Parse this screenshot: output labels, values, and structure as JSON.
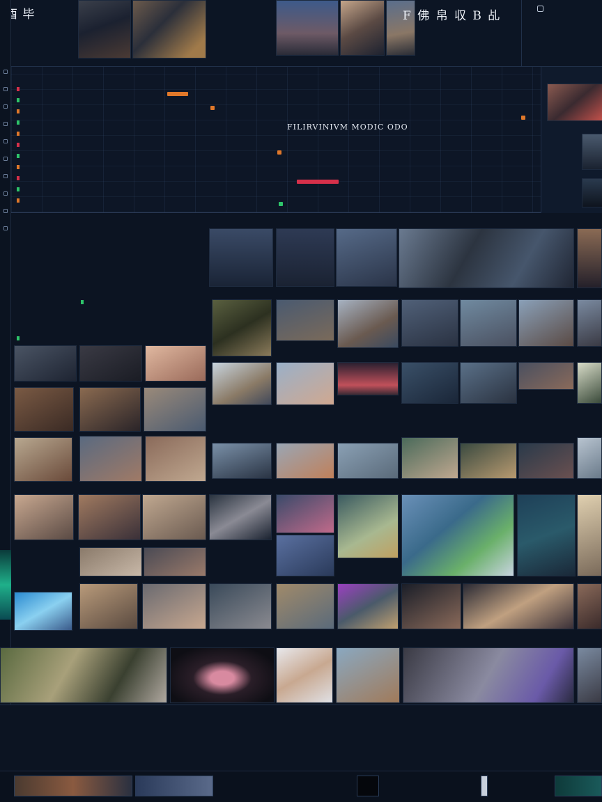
{
  "header": {
    "app_title": "酉 毕",
    "title_right": "F 佛 帛  収 B 乩"
  },
  "dashboard": {
    "heading": "FILIRVINIVM  MODIC ODO"
  },
  "colors": {
    "background": "#0e1727",
    "panel": "#0c1422",
    "accent_orange": "#e0782a",
    "accent_green": "#2ec46a",
    "accent_red": "#d6304a",
    "accent_teal": "#1fb08a"
  },
  "icons": [
    "settings-icon",
    "folder-icon",
    "play-icon",
    "timeline-icon"
  ]
}
